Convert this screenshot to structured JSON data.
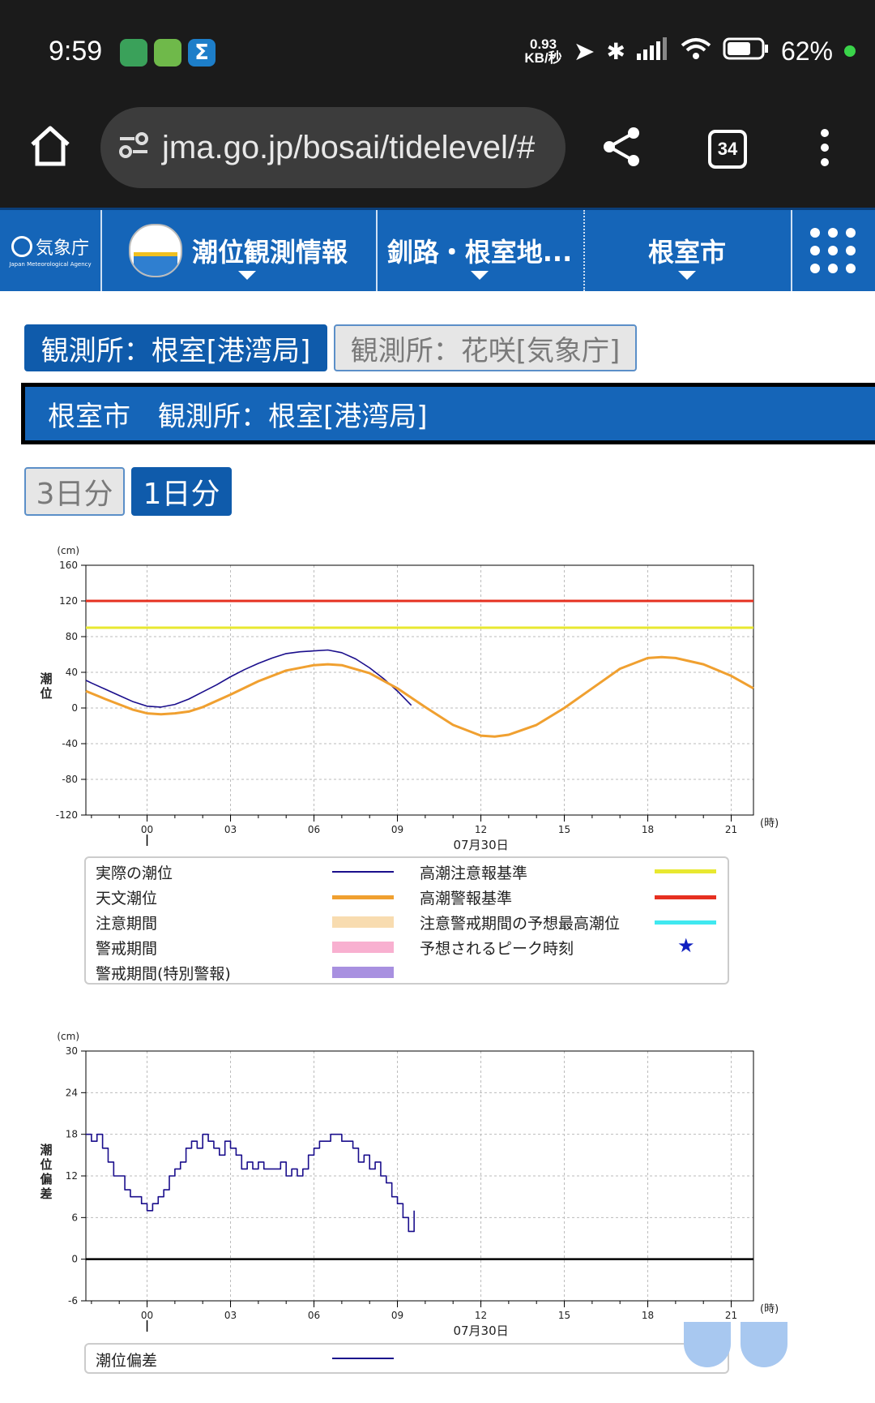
{
  "status": {
    "time": "9:59",
    "net_speed_value": "0.93",
    "net_speed_unit": "KB/秒",
    "battery": "62%"
  },
  "browser": {
    "url": "jma.go.jp/bosai/tidelevel/#",
    "tab_count": "34"
  },
  "nav": {
    "logo_text": "気象庁",
    "logo_sub": "Japan Meteorological Agency",
    "section": "潮位観測情報",
    "region": "釧路・根室地...",
    "city": "根室市"
  },
  "station_tabs": [
    "観測所：根室[港湾局]",
    "観測所：花咲[気象庁]"
  ],
  "heading": "根室市　観測所：根室[港湾局]",
  "period_tabs": [
    "3日分",
    "1日分"
  ],
  "colors": {
    "brand": "#1565b8",
    "actual": "#1a0e8c",
    "astronomical": "#f0a030",
    "warning_ref": "#e8e830",
    "alert_ref": "#e63020",
    "predicted_max": "#40e8f0",
    "caution_period": "#f8dcb0",
    "warning_period": "#f8b0d0",
    "special_period": "#a890e0",
    "peak_star": "#1020c0"
  },
  "legend": {
    "actual": "実際の潮位",
    "astronomical": "天文潮位",
    "caution_period": "注意期間",
    "warning_period": "警戒期間",
    "special_period": "警戒期間(特別警報)",
    "high_tide_advisory": "高潮注意報基準",
    "high_tide_warning": "高潮警報基準",
    "predicted_max": "注意警戒期間の予想最高潮位",
    "peak_time": "予想されるピーク時刻",
    "deviation": "潮位偏差"
  },
  "chart_data": [
    {
      "type": "line",
      "unit_label": "(cm)",
      "ylabel": "潮位",
      "xlabel": "07月30日",
      "x_unit": "(時)",
      "x_ticks": [
        "00",
        "03",
        "06",
        "09",
        "12",
        "15",
        "18",
        "21"
      ],
      "x_range_hours": [
        -2.2,
        21.8
      ],
      "ylim": [
        -120,
        160
      ],
      "y_ticks": [
        160,
        120,
        80,
        40,
        0,
        -40,
        -80,
        -120
      ],
      "thresholds": [
        {
          "name": "高潮警報基準",
          "value": 120
        },
        {
          "name": "高潮注意報基準",
          "value": 90
        }
      ],
      "series": [
        {
          "name": "実際の潮位",
          "x": [
            -2.2,
            -2,
            -1.5,
            -1,
            -0.5,
            0,
            0.5,
            1,
            1.5,
            2,
            2.5,
            3,
            3.5,
            4,
            4.5,
            5,
            5.5,
            6,
            6.5,
            7,
            7.5,
            8,
            8.5,
            9,
            9.5
          ],
          "y": [
            31,
            28,
            21,
            14,
            7,
            2,
            1,
            4,
            10,
            18,
            26,
            35,
            43,
            50,
            56,
            61,
            63,
            64,
            65,
            62,
            55,
            45,
            33,
            19,
            3
          ]
        },
        {
          "name": "天文潮位",
          "x": [
            -2.2,
            -1.5,
            -1,
            -0.5,
            0,
            0.5,
            1,
            1.5,
            2,
            3,
            4,
            5,
            6,
            6.5,
            7,
            8,
            9,
            10,
            11,
            12,
            12.5,
            13,
            14,
            15,
            16,
            17,
            18,
            18.5,
            19,
            20,
            21,
            21.8
          ],
          "y": [
            19,
            10,
            4,
            -2,
            -6,
            -7,
            -6,
            -4,
            1,
            15,
            30,
            42,
            48,
            49,
            48,
            39,
            22,
            1,
            -19,
            -31,
            -32,
            -30,
            -19,
            0,
            22,
            44,
            56,
            57,
            56,
            49,
            36,
            22
          ]
        }
      ]
    },
    {
      "type": "line",
      "unit_label": "(cm)",
      "ylabel": "潮位偏差",
      "xlabel": "07月30日",
      "x_unit": "(時)",
      "x_ticks": [
        "00",
        "03",
        "06",
        "09",
        "12",
        "15",
        "18",
        "21"
      ],
      "x_range_hours": [
        -2.2,
        21.8
      ],
      "ylim": [
        -6,
        30
      ],
      "y_ticks": [
        30,
        24,
        18,
        12,
        6,
        0,
        -6
      ],
      "series": [
        {
          "name": "潮位偏差",
          "x": [
            -2.2,
            -2,
            -1.8,
            -1.6,
            -1.4,
            -1.2,
            -1,
            -0.8,
            -0.6,
            -0.4,
            -0.2,
            0,
            0.2,
            0.4,
            0.6,
            0.8,
            1,
            1.2,
            1.4,
            1.6,
            1.8,
            2,
            2.2,
            2.4,
            2.6,
            2.8,
            3,
            3.2,
            3.4,
            3.6,
            3.8,
            4,
            4.2,
            4.4,
            4.6,
            4.8,
            5,
            5.2,
            5.4,
            5.6,
            5.8,
            6,
            6.2,
            6.4,
            6.6,
            6.8,
            7,
            7.2,
            7.4,
            7.6,
            7.8,
            8,
            8.2,
            8.4,
            8.6,
            8.8,
            9,
            9.2,
            9.4,
            9.6
          ],
          "y": [
            18,
            17,
            18,
            16,
            14,
            12,
            12,
            10,
            9,
            9,
            8,
            7,
            8,
            9,
            10,
            12,
            13,
            14,
            16,
            17,
            16,
            18,
            17,
            16,
            15,
            17,
            16,
            15,
            13,
            14,
            13,
            14,
            13,
            13,
            13,
            14,
            12,
            13,
            12,
            13,
            15,
            16,
            17,
            17,
            18,
            18,
            17,
            17,
            16,
            14,
            15,
            13,
            14,
            12,
            11,
            9,
            8,
            6,
            4,
            7
          ]
        }
      ]
    }
  ]
}
